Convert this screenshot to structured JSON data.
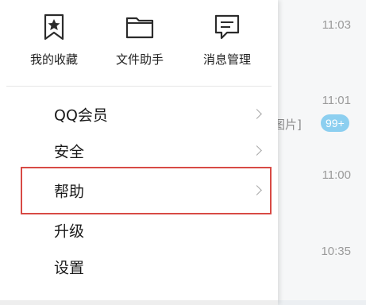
{
  "background": {
    "times": [
      "11:03",
      "11:01",
      "11:00",
      "10:35"
    ],
    "snippet": "图片]",
    "badge": "99+"
  },
  "quick_actions": [
    {
      "label": "我的收藏",
      "icon": "bookmark-star-icon"
    },
    {
      "label": "文件助手",
      "icon": "folder-icon"
    },
    {
      "label": "消息管理",
      "icon": "message-bubble-icon"
    }
  ],
  "menu": {
    "items": [
      {
        "label": "QQ会员",
        "has_submenu": true
      },
      {
        "label": "安全",
        "has_submenu": true
      },
      {
        "label": "帮助",
        "has_submenu": true,
        "highlighted": true
      },
      {
        "label": "升级",
        "has_submenu": false
      },
      {
        "label": "设置",
        "has_submenu": false
      }
    ]
  },
  "colors": {
    "highlight_border": "#d84a45",
    "badge": "#8ccff0",
    "time_text": "#9a9a9a"
  }
}
